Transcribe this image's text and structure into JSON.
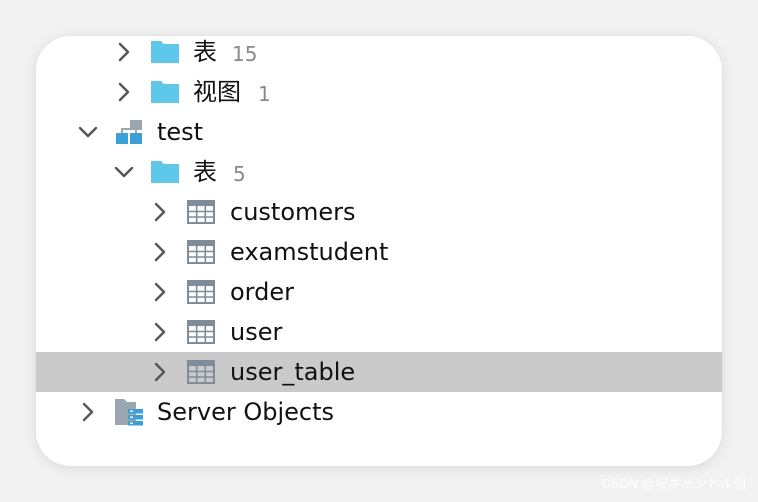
{
  "colors": {
    "folder": "#5fc7ea",
    "table_grid": "#7e8d99",
    "schema_blue": "#3aa0d6",
    "selection": "#cacaca"
  },
  "tree": {
    "tables_group_1": {
      "label": "表",
      "count": "15",
      "icon": "folder-icon"
    },
    "views_group": {
      "label": "视图",
      "count": "1",
      "icon": "folder-icon"
    },
    "schema_test": {
      "label": "test",
      "icon": "database-schema-icon"
    },
    "tables_group_2": {
      "label": "表",
      "count": "5",
      "icon": "folder-icon"
    },
    "tables": [
      {
        "label": "customers",
        "icon": "table-icon"
      },
      {
        "label": "examstudent",
        "icon": "table-icon"
      },
      {
        "label": "order",
        "icon": "table-icon"
      },
      {
        "label": "user",
        "icon": "table-icon"
      },
      {
        "label": "user_table",
        "icon": "table-icon",
        "selected": true
      }
    ],
    "server_objects": {
      "label": "Server Objects",
      "icon": "server-objects-icon"
    }
  },
  "watermark": "CSDN @桜キャンドル淵"
}
